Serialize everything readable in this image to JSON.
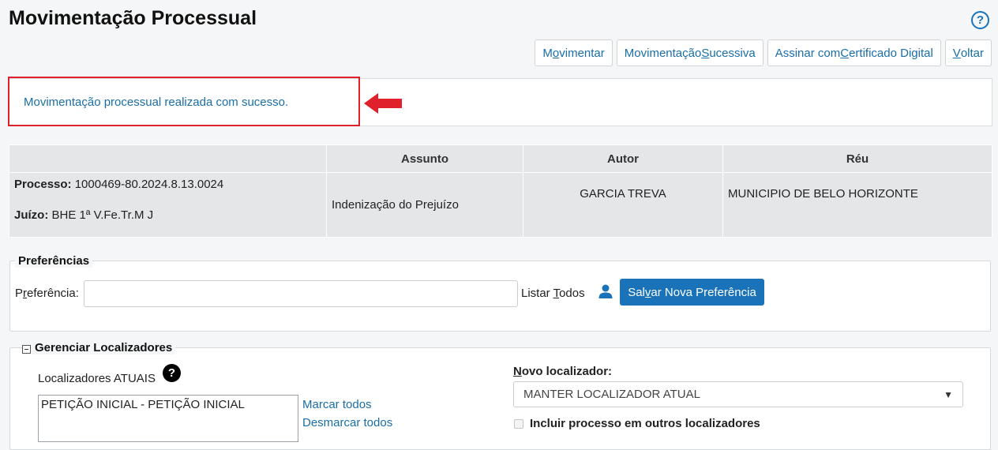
{
  "header": {
    "title": "Movimentação Processual",
    "help_icon": "?"
  },
  "toolbar": {
    "buttons": [
      {
        "pre": "M",
        "key": "o",
        "post": "vimentar"
      },
      {
        "pre": "Movimentação ",
        "key": "S",
        "post": "ucessiva"
      },
      {
        "pre": "Assinar com ",
        "key": "C",
        "post": "ertificado Digital"
      },
      {
        "pre": "",
        "key": "V",
        "post": "oltar"
      }
    ]
  },
  "message": {
    "text": "Movimentação processual realizada com sucesso.",
    "highlight_color": "#e0202a"
  },
  "process_table": {
    "headers": [
      "",
      "Assunto",
      "Autor",
      "Réu"
    ],
    "processo_label": "Processo:",
    "processo_value": "1000469-80.2024.8.13.0024",
    "juizo_label": "Juízo:",
    "juizo_value": "BHE 1ª V.Fe.Tr.M J",
    "assunto": "Indenização do Prejuízo",
    "autor": "GARCIA TREVA",
    "reu": "MUNICIPIO DE BELO HORIZONTE"
  },
  "preferences": {
    "legend": "Preferências",
    "label_pre": "P",
    "label_key": "r",
    "label_post": "eferência:",
    "input_value": "",
    "listar_pre": "Listar ",
    "listar_key": "T",
    "listar_post": "odos",
    "save_pre": "Sal",
    "save_key": "v",
    "save_post": "ar Nova Preferência"
  },
  "localizadores": {
    "legend": "Gerenciar Localizadores",
    "atuais_label": "Localizadores ATUAIS",
    "atuais_items": [
      "PETIÇÃO INICIAL - PETIÇÃO INICIAL"
    ],
    "marcar_todos": "Marcar todos",
    "desmarcar_todos": "Desmarcar todos",
    "novo_label_key": "N",
    "novo_label_post": "ovo localizador:",
    "novo_selected": "MANTER LOCALIZADOR ATUAL",
    "incluir_label": "Incluir processo em outros localizadores",
    "incluir_checked": false
  },
  "colors": {
    "accent": "#1a73b8",
    "link": "#1a6ea6"
  }
}
